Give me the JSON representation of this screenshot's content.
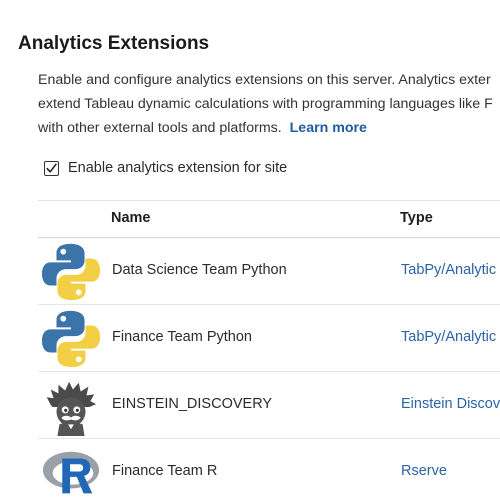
{
  "page": {
    "title": "Analytics Extensions",
    "description": {
      "line1": "Enable and configure analytics extensions on this server. Analytics exter",
      "line2": "extend Tableau dynamic calculations with programming languages like F",
      "line3": "with other external tools and platforms.",
      "learn_more": "Learn more"
    },
    "enable_checkbox": {
      "label": "Enable analytics extension for site",
      "checked": true
    }
  },
  "table": {
    "headers": {
      "name": "Name",
      "type": "Type"
    },
    "rows": [
      {
        "name": "Data Science Team Python",
        "type": "TabPy/Analytic",
        "icon": "python-icon"
      },
      {
        "name": "Finance Team Python",
        "type": "TabPy/Analytic",
        "icon": "python-icon"
      },
      {
        "name": "EINSTEIN_DISCOVERY",
        "type": "Einstein Discov",
        "icon": "einstein-icon"
      },
      {
        "name": "Finance Team R",
        "type": "Rserve",
        "icon": "r-logo-icon"
      }
    ]
  },
  "colors": {
    "link": "#1f5b9f",
    "type_link": "#2a63a6",
    "python_blue": "#3b74a8",
    "python_yellow": "#f2cf45",
    "r_blue": "#2266b8",
    "r_gray": "#9aa0a8"
  }
}
